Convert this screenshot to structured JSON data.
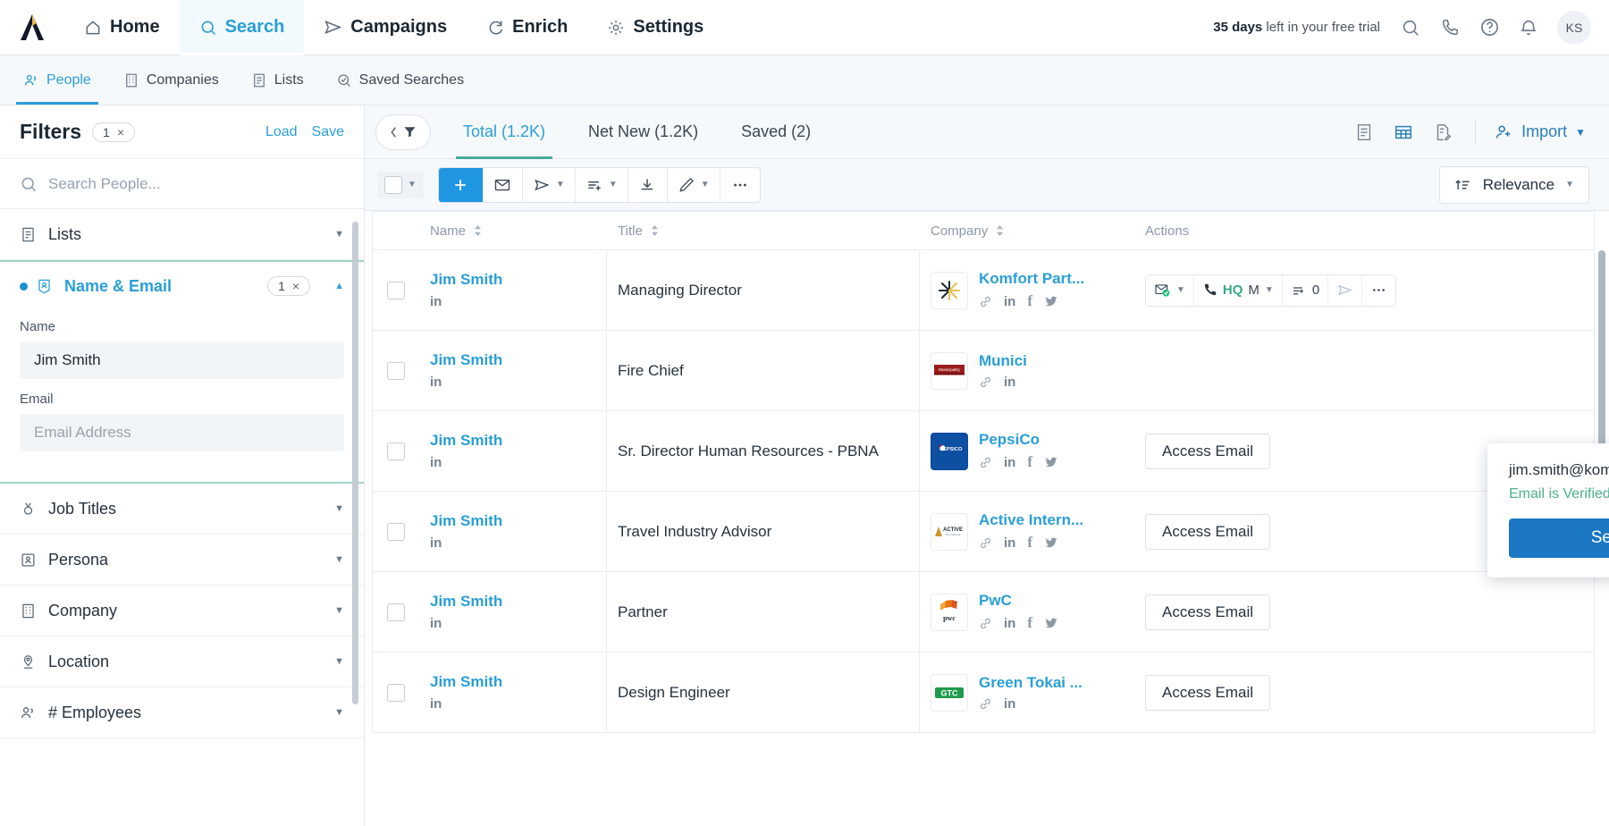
{
  "topnav": {
    "logo_name": "apollo-logo",
    "items": [
      {
        "label": "Home",
        "icon": "home-icon",
        "active": false
      },
      {
        "label": "Search",
        "icon": "search-icon",
        "active": true
      },
      {
        "label": "Campaigns",
        "icon": "send-icon",
        "active": false
      },
      {
        "label": "Enrich",
        "icon": "refresh-icon",
        "active": false
      },
      {
        "label": "Settings",
        "icon": "gear-icon",
        "active": false
      }
    ],
    "trial_bold": "35 days",
    "trial_rest": " left in your free trial",
    "icons": [
      "search-icon",
      "phone-icon",
      "help-icon",
      "bell-icon"
    ],
    "avatar_initials": "KS"
  },
  "subnav": {
    "items": [
      {
        "label": "People",
        "icon": "people-icon",
        "active": true
      },
      {
        "label": "Companies",
        "icon": "building-icon",
        "active": false
      },
      {
        "label": "Lists",
        "icon": "list-icon",
        "active": false
      },
      {
        "label": "Saved Searches",
        "icon": "saved-search-icon",
        "active": false
      }
    ]
  },
  "sidebar": {
    "title": "Filters",
    "filter_count": "1",
    "clear_glyph": "×",
    "load_label": "Load",
    "save_label": "Save",
    "search_placeholder": "Search People...",
    "facets": [
      {
        "label": "Lists",
        "icon": "list-icon",
        "open": false,
        "count": null
      },
      {
        "label": "Name & Email",
        "icon": "contact-card-icon",
        "open": true,
        "count": "1"
      },
      {
        "label": "Job Titles",
        "icon": "badge-icon",
        "open": false,
        "count": null
      },
      {
        "label": "Persona",
        "icon": "persona-icon",
        "open": false,
        "count": null
      },
      {
        "label": "Company",
        "icon": "building-icon",
        "open": false,
        "count": null
      },
      {
        "label": "Location",
        "icon": "pin-icon",
        "open": false,
        "count": null
      },
      {
        "label": "# Employees",
        "icon": "people-icon",
        "open": false,
        "count": null
      }
    ],
    "name_email": {
      "name_label": "Name",
      "name_value": "Jim Smith",
      "email_label": "Email",
      "email_placeholder": "Email Address"
    }
  },
  "main": {
    "filter_toggle_icon": "collapse-filter-icon",
    "tabs": [
      {
        "label": "Total (1.2K)",
        "active": true
      },
      {
        "label": "Net New (1.2K)",
        "active": false
      },
      {
        "label": "Saved (2)",
        "active": false
      }
    ],
    "view_icons": [
      {
        "name": "list-view-icon",
        "active": false
      },
      {
        "name": "table-view-icon",
        "active": true
      },
      {
        "name": "doc-edit-view-icon",
        "active": false
      }
    ],
    "import_label": "Import",
    "toolbar": {
      "select_all_icon": "checkbox-dropdown",
      "buttons": [
        {
          "name": "add-icon",
          "primary": true,
          "caret": false
        },
        {
          "name": "email-icon",
          "primary": false,
          "caret": false
        },
        {
          "name": "sequence-icon",
          "primary": false,
          "caret": true
        },
        {
          "name": "add-to-list-icon",
          "primary": false,
          "caret": true
        },
        {
          "name": "download-icon",
          "primary": false,
          "caret": false
        },
        {
          "name": "edit-icon",
          "primary": false,
          "caret": true
        },
        {
          "name": "more-icon",
          "primary": false,
          "caret": false
        }
      ],
      "sort_label": "Relevance",
      "sort_icon": "sort-icon"
    },
    "columns": [
      "Name",
      "Title",
      "Company",
      "Actions"
    ],
    "rows": [
      {
        "name": "Jim Smith",
        "title": "Managing Director",
        "company": "Komfort Part...",
        "logo": "komfort",
        "socials": [
          "link-icon",
          "linkedin-icon",
          "facebook-icon",
          "twitter-icon"
        ],
        "action_type": "group",
        "action_group": {
          "email_icon": "email-verified-icon",
          "phone_icon": "phone-icon",
          "hq": "HQ",
          "mobile": "M",
          "list_count": "0",
          "send_icon": "send-icon",
          "more_icon": "more-icon"
        }
      },
      {
        "name": "Jim Smith",
        "title": "Fire Chief",
        "company": "Munici",
        "logo": "municipality",
        "socials": [
          "link-icon",
          "linkedin-icon"
        ],
        "action_type": "hidden",
        "action_label": ""
      },
      {
        "name": "Jim Smith",
        "title": "Sr. Director Human Resources - PBNA",
        "company": "PepsiCo",
        "logo": "pepsico",
        "socials": [
          "link-icon",
          "linkedin-icon",
          "facebook-icon",
          "twitter-icon"
        ],
        "action_type": "button",
        "action_label": "Access Email"
      },
      {
        "name": "Jim Smith",
        "title": "Travel Industry Advisor",
        "company": "Active Intern...",
        "logo": "active",
        "socials": [
          "link-icon",
          "linkedin-icon",
          "facebook-icon",
          "twitter-icon"
        ],
        "action_type": "button",
        "action_label": "Access Email"
      },
      {
        "name": "Jim Smith",
        "title": "Partner",
        "company": "PwC",
        "logo": "pwc",
        "socials": [
          "link-icon",
          "linkedin-icon",
          "facebook-icon",
          "twitter-icon"
        ],
        "action_type": "button",
        "action_label": "Access Email"
      },
      {
        "name": "Jim Smith",
        "title": "Design Engineer",
        "company": "Green Tokai ...",
        "logo": "greentokai",
        "socials": [
          "link-icon",
          "linkedin-icon"
        ],
        "action_type": "button",
        "action_label": "Access Email"
      }
    ]
  },
  "popover": {
    "email": "jim.smith@komfort.co.uk",
    "copy_icon": "copy-icon",
    "verified_text": "Email is Verified",
    "button_label": "Send an Email"
  },
  "colors": {
    "accent_blue": "#2a9fd6",
    "primary_blue": "#2196e3",
    "teal_underline": "#4aa8a0",
    "verified_green": "#4bb08a",
    "send_button": "#1b77c4"
  }
}
